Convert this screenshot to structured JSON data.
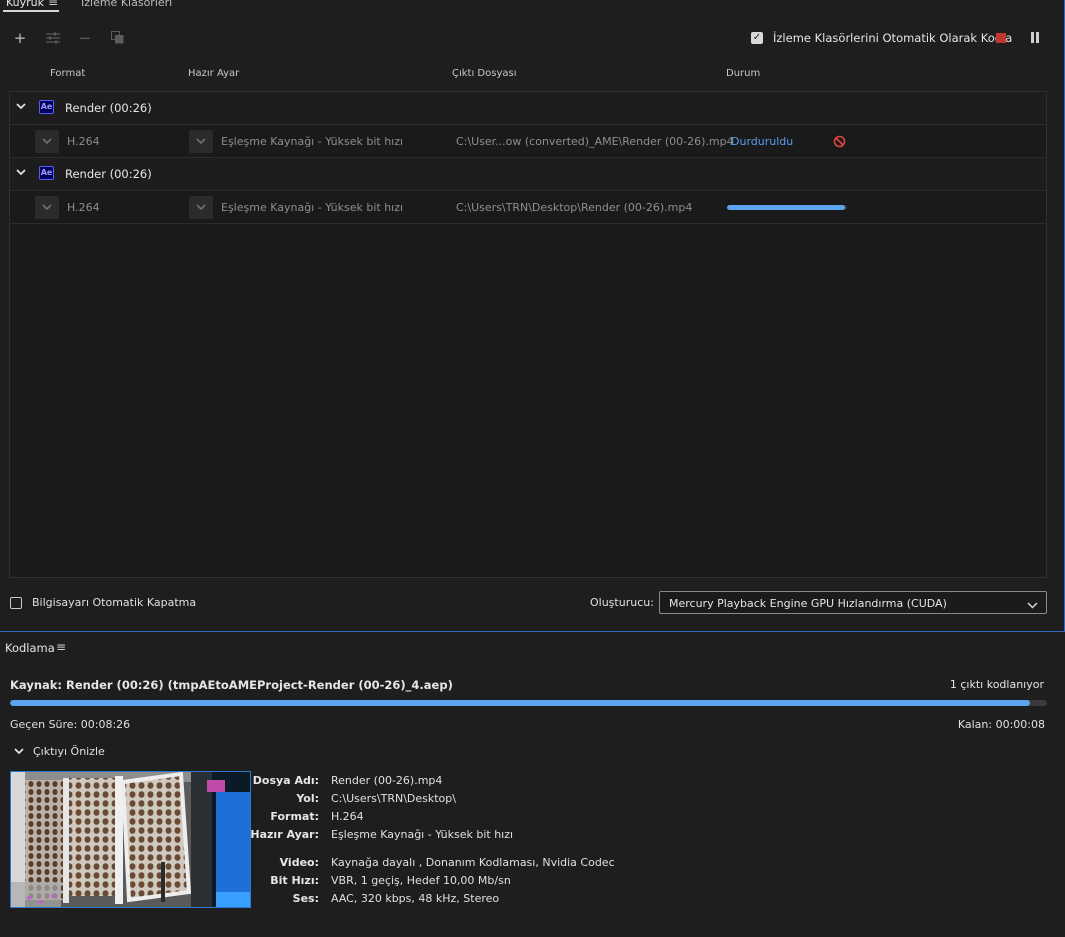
{
  "queue": {
    "tabs": [
      {
        "label": "Kuyruk"
      },
      {
        "label": "İzleme Klasörleri"
      }
    ],
    "auto_encode_label": "İzleme Klasörlerini Otomatik Olarak Kodla",
    "auto_encode_checked": true,
    "columns": {
      "format": "Format",
      "preset": "Hazır Ayar",
      "output": "Çıktı Dosyası",
      "status": "Durum"
    },
    "groups": [
      {
        "title": "Render (00:26)",
        "app_badge": "Ae",
        "item": {
          "format": "H.264",
          "preset": "Eşleşme Kaynağı - Yüksek bit hızı",
          "output": "C:\\User...ow (converted)_AME\\Render (00-26).mp4",
          "status": "Durduruldu",
          "status_icon": "ban-icon"
        }
      },
      {
        "title": "Render (00:26)",
        "app_badge": "Ae",
        "item": {
          "format": "H.264",
          "preset": "Eşleşme Kaynağı - Yüksek bit hızı",
          "output": "C:\\Users\\TRN\\Desktop\\Render (00-26).mp4",
          "progress_fraction": 0.98
        }
      }
    ],
    "auto_shutdown_label": "Bilgisayarı Otomatik Kapatma",
    "auto_shutdown_checked": false,
    "renderer_label": "Oluşturucu:",
    "renderer_value": "Mercury Playback Engine GPU Hızlandırma (CUDA)"
  },
  "encoding": {
    "title": "Kodlama",
    "source": "Kaynak: Render (00:26) (tmpAEtoAMEProject-Render (00-26)_4.aep)",
    "outputs": "1 çıktı kodlanıyor",
    "progress_fraction": 0.984,
    "elapsed": "Geçen Süre: 00:08:26",
    "remaining": "Kalan: 00:00:08",
    "preview_label": "Çıktıyı Önizle",
    "details": [
      {
        "label": "Dosya Adı:",
        "value": "Render (00-26).mp4"
      },
      {
        "label": "Yol:",
        "value": "C:\\Users\\TRN\\Desktop\\"
      },
      {
        "label": "Format:",
        "value": "H.264"
      },
      {
        "label": "Hazır Ayar:",
        "value": "Eşleşme Kaynağı - Yüksek bit hızı"
      },
      {
        "label": "Video:",
        "value": "Kaynağa dayalı , Donanım Kodlaması, Nvidia Codec"
      },
      {
        "label": "Bit Hızı:",
        "value": "VBR, 1 geçiş, Hedef 10,00 Mb/sn"
      },
      {
        "label": "Ses:",
        "value": "AAC, 320 kbps, 48 kHz, Stereo"
      }
    ]
  },
  "colors": {
    "accent": "#5ca3f0",
    "stop": "#c0382b",
    "status_paused": "#5a9df0",
    "ban": "#e0453a",
    "ae_badge": "#00005b"
  }
}
